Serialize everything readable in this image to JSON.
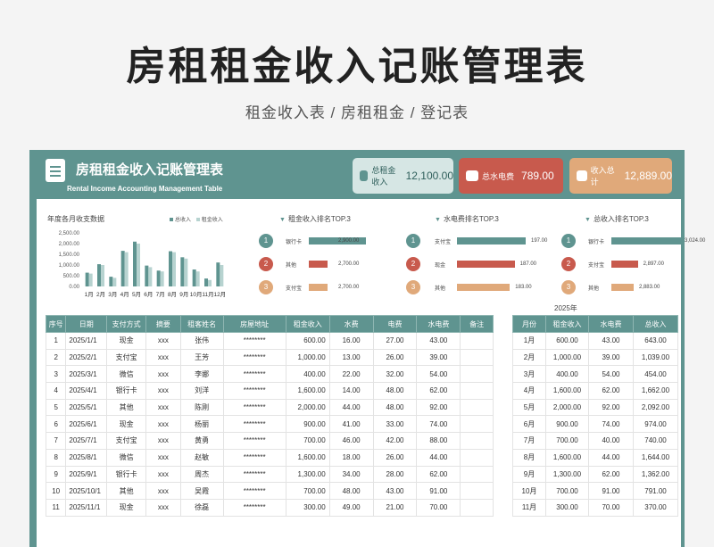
{
  "page": {
    "title": "房租租金收入记账管理表",
    "subtitle": "租金收入表 / 房租租金 / 登记表"
  },
  "header": {
    "title": "房租租金收入记账管理表",
    "subtitle_en": "Rental Income Accounting Management Table",
    "icon": "document-icon"
  },
  "cards": [
    {
      "label": "总租金收入",
      "value": "12,100.00",
      "icon": "bus-icon",
      "color": "#5f9490"
    },
    {
      "label": "总水电费",
      "value": "789.00",
      "icon": "bag-icon",
      "color": "#c85a4d"
    },
    {
      "label": "收入总计",
      "value": "12,889.00",
      "icon": "calendar-icon",
      "color": "#e0a97a"
    }
  ],
  "chart_data": {
    "type": "bar",
    "title": "年度各月收支数据",
    "legend": [
      "总收入",
      "租金收入"
    ],
    "categories": [
      "1月",
      "2月",
      "3月",
      "4月",
      "5月",
      "6月",
      "7月",
      "8月",
      "9月",
      "10月",
      "11月",
      "12月"
    ],
    "series": [
      {
        "name": "总收入",
        "values": [
          643,
          1039,
          454,
          1662,
          2092,
          974,
          740,
          1644,
          1362,
          791,
          370,
          1118
        ]
      },
      {
        "name": "租金收入",
        "values": [
          600,
          1000,
          400,
          1600,
          2000,
          900,
          700,
          1600,
          1300,
          700,
          300,
          1000
        ]
      }
    ],
    "yticks": [
      "2,500.00",
      "2,000.00",
      "1,500.00",
      "1,000.00",
      "500.00",
      "0.00"
    ],
    "ylim": [
      0,
      2500
    ],
    "colors": {
      "总收入": "#5f9490",
      "租金收入": "#b7d3d0"
    }
  },
  "rankings": [
    {
      "title": "租金收入排名TOP.3",
      "items": [
        {
          "rank": "1",
          "name": "银行卡",
          "value": "2,900.00",
          "frac": 1.0
        },
        {
          "rank": "2",
          "name": "其他",
          "value": "2,700.00",
          "frac": 0.33
        },
        {
          "rank": "3",
          "name": "支付宝",
          "value": "2,700.00",
          "frac": 0.33
        }
      ]
    },
    {
      "title": "水电费排名TOP.3",
      "items": [
        {
          "rank": "1",
          "name": "支付宝",
          "value": "197.00",
          "frac": 1.0
        },
        {
          "rank": "2",
          "name": "现金",
          "value": "187.00",
          "frac": 0.84
        },
        {
          "rank": "3",
          "name": "其他",
          "value": "183.00",
          "frac": 0.77
        }
      ]
    },
    {
      "title": "总收入排名TOP.3",
      "items": [
        {
          "rank": "1",
          "name": "银行卡",
          "value": "3,024.00",
          "frac": 1.0
        },
        {
          "rank": "2",
          "name": "支付宝",
          "value": "2,897.00",
          "frac": 0.38
        },
        {
          "rank": "3",
          "name": "其他",
          "value": "2,883.00",
          "frac": 0.32
        }
      ]
    }
  ],
  "main_table": {
    "headers": [
      "序号",
      "日期",
      "支付方式",
      "摘要",
      "租客姓名",
      "房屋地址",
      "租金收入",
      "水费",
      "电费",
      "水电费",
      "备注"
    ],
    "rows": [
      [
        "1",
        "2025/1/1",
        "现金",
        "xxx",
        "张伟",
        "********",
        "600.00",
        "16.00",
        "27.00",
        "43.00",
        ""
      ],
      [
        "2",
        "2025/2/1",
        "支付宝",
        "xxx",
        "王芳",
        "********",
        "1,000.00",
        "13.00",
        "26.00",
        "39.00",
        ""
      ],
      [
        "3",
        "2025/3/1",
        "微信",
        "xxx",
        "李娜",
        "********",
        "400.00",
        "22.00",
        "32.00",
        "54.00",
        ""
      ],
      [
        "4",
        "2025/4/1",
        "银行卡",
        "xxx",
        "刘洋",
        "********",
        "1,600.00",
        "14.00",
        "48.00",
        "62.00",
        ""
      ],
      [
        "5",
        "2025/5/1",
        "其他",
        "xxx",
        "陈刚",
        "********",
        "2,000.00",
        "44.00",
        "48.00",
        "92.00",
        ""
      ],
      [
        "6",
        "2025/6/1",
        "现金",
        "xxx",
        "杨丽",
        "********",
        "900.00",
        "41.00",
        "33.00",
        "74.00",
        ""
      ],
      [
        "7",
        "2025/7/1",
        "支付宝",
        "xxx",
        "黄勇",
        "********",
        "700.00",
        "46.00",
        "42.00",
        "88.00",
        ""
      ],
      [
        "8",
        "2025/8/1",
        "微信",
        "xxx",
        "赵敏",
        "********",
        "1,600.00",
        "18.00",
        "26.00",
        "44.00",
        ""
      ],
      [
        "9",
        "2025/9/1",
        "银行卡",
        "xxx",
        "周杰",
        "********",
        "1,300.00",
        "34.00",
        "28.00",
        "62.00",
        ""
      ],
      [
        "10",
        "2025/10/1",
        "其他",
        "xxx",
        "吴霞",
        "********",
        "700.00",
        "48.00",
        "43.00",
        "91.00",
        ""
      ],
      [
        "11",
        "2025/11/1",
        "现金",
        "xxx",
        "徐磊",
        "********",
        "300.00",
        "49.00",
        "21.00",
        "70.00",
        ""
      ]
    ]
  },
  "month_table": {
    "year": "2025年",
    "headers": [
      "月份",
      "租金收入",
      "水电费",
      "总收入"
    ],
    "rows": [
      [
        "1月",
        "600.00",
        "43.00",
        "643.00"
      ],
      [
        "2月",
        "1,000.00",
        "39.00",
        "1,039.00"
      ],
      [
        "3月",
        "400.00",
        "54.00",
        "454.00"
      ],
      [
        "4月",
        "1,600.00",
        "62.00",
        "1,662.00"
      ],
      [
        "5月",
        "2,000.00",
        "92.00",
        "2,092.00"
      ],
      [
        "6月",
        "900.00",
        "74.00",
        "974.00"
      ],
      [
        "7月",
        "700.00",
        "40.00",
        "740.00"
      ],
      [
        "8月",
        "1,600.00",
        "44.00",
        "1,644.00"
      ],
      [
        "9月",
        "1,300.00",
        "62.00",
        "1,362.00"
      ],
      [
        "10月",
        "700.00",
        "91.00",
        "791.00"
      ],
      [
        "11月",
        "300.00",
        "70.00",
        "370.00"
      ]
    ]
  }
}
